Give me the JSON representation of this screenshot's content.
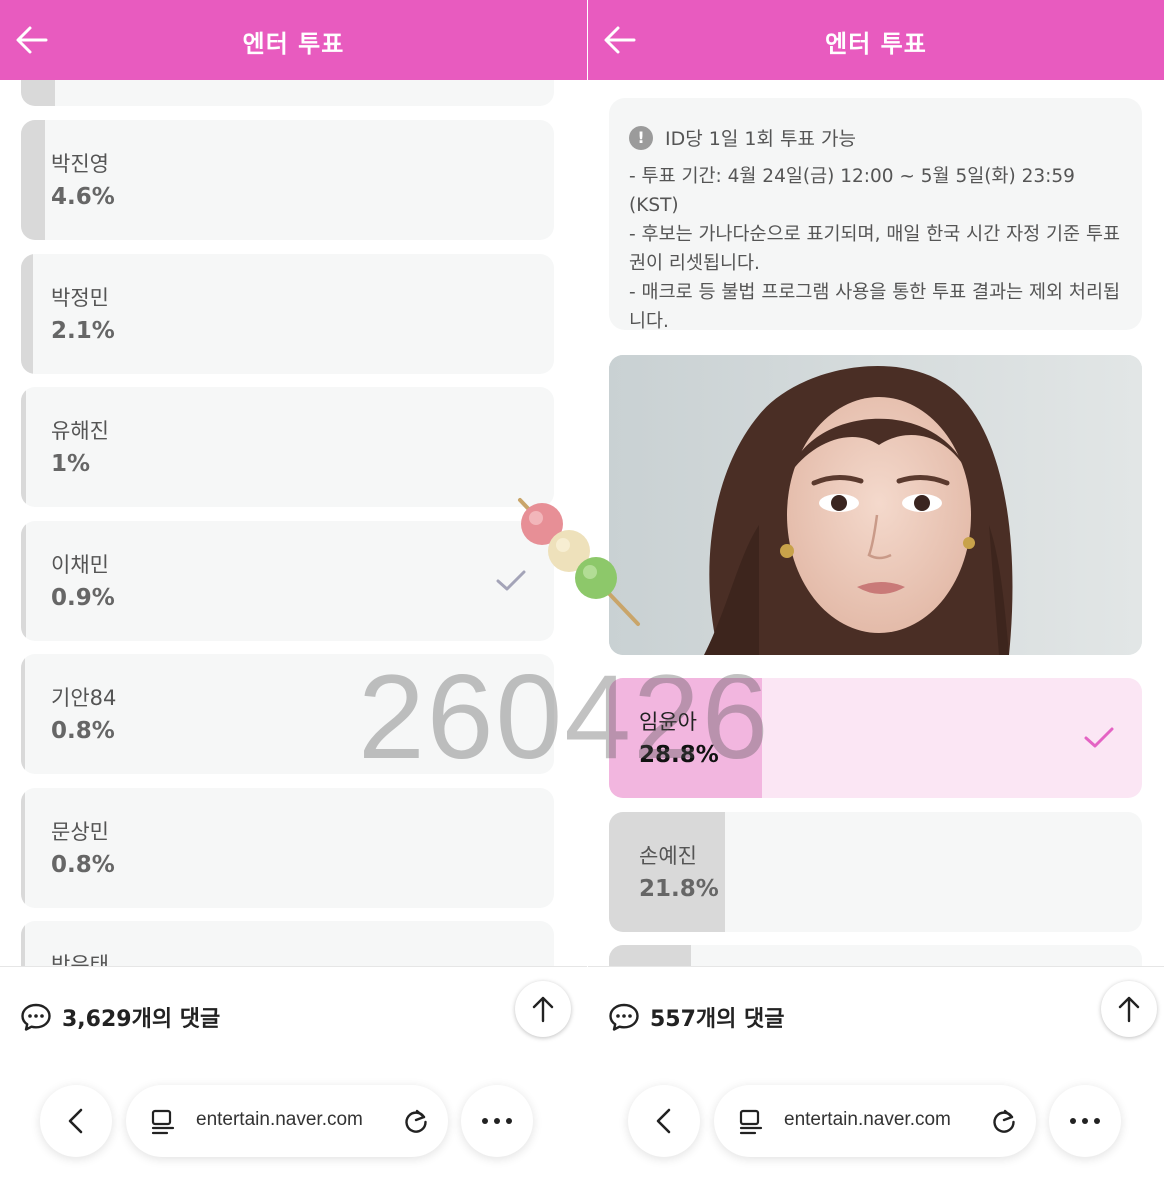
{
  "left": {
    "header_title": "엔터 투표",
    "candidates": [
      {
        "name": "",
        "pct": "",
        "fill": 0.06
      },
      {
        "name": "박진영",
        "pct": "4.6%",
        "fill": 0.046
      },
      {
        "name": "박정민",
        "pct": "2.1%",
        "fill": 0.021
      },
      {
        "name": "유해진",
        "pct": "1%",
        "fill": 0.01
      },
      {
        "name": "이채민",
        "pct": "0.9%",
        "fill": 0.009,
        "checked": true
      },
      {
        "name": "기안84",
        "pct": "0.8%",
        "fill": 0.008
      },
      {
        "name": "문상민",
        "pct": "0.8%",
        "fill": 0.008
      },
      {
        "name": "박은태",
        "pct": "",
        "fill": 0.008
      }
    ],
    "comments_label": "3,629개의 댓글",
    "url": "entertain.naver.com"
  },
  "right": {
    "header_title": "엔터 투표",
    "notice_title": "ID당 1일 1회 투표 가능",
    "notice_lines": [
      "- 투표 기간: 4월 24일(금) 12:00 ~ 5월 5일(화) 23:59 (KST)",
      "- 후보는 가나다순으로 표기되며, 매일 한국 시간 자정 기준 투표",
      "권이 리셋됩니다.",
      "- 매크로 등 불법 프로그램 사용을 통한 투표 결과는 제외 처리됩",
      "니다."
    ],
    "candidates": [
      {
        "name": "임윤아",
        "pct": "28.8%",
        "fill": 0.288,
        "checked": true
      },
      {
        "name": "손예진",
        "pct": "21.8%",
        "fill": 0.218
      },
      {
        "name": "",
        "pct": "",
        "fill": 0.15
      }
    ],
    "comments_label": "557개의 댓글",
    "url": "entertain.naver.com"
  },
  "watermark": "260426",
  "colors": {
    "header": "#e85bbf",
    "selected_fill": "#f2b6df",
    "selected_bg": "#fbe6f4",
    "check_pink": "#e463c3",
    "check_gray": "#a4a4b8"
  }
}
